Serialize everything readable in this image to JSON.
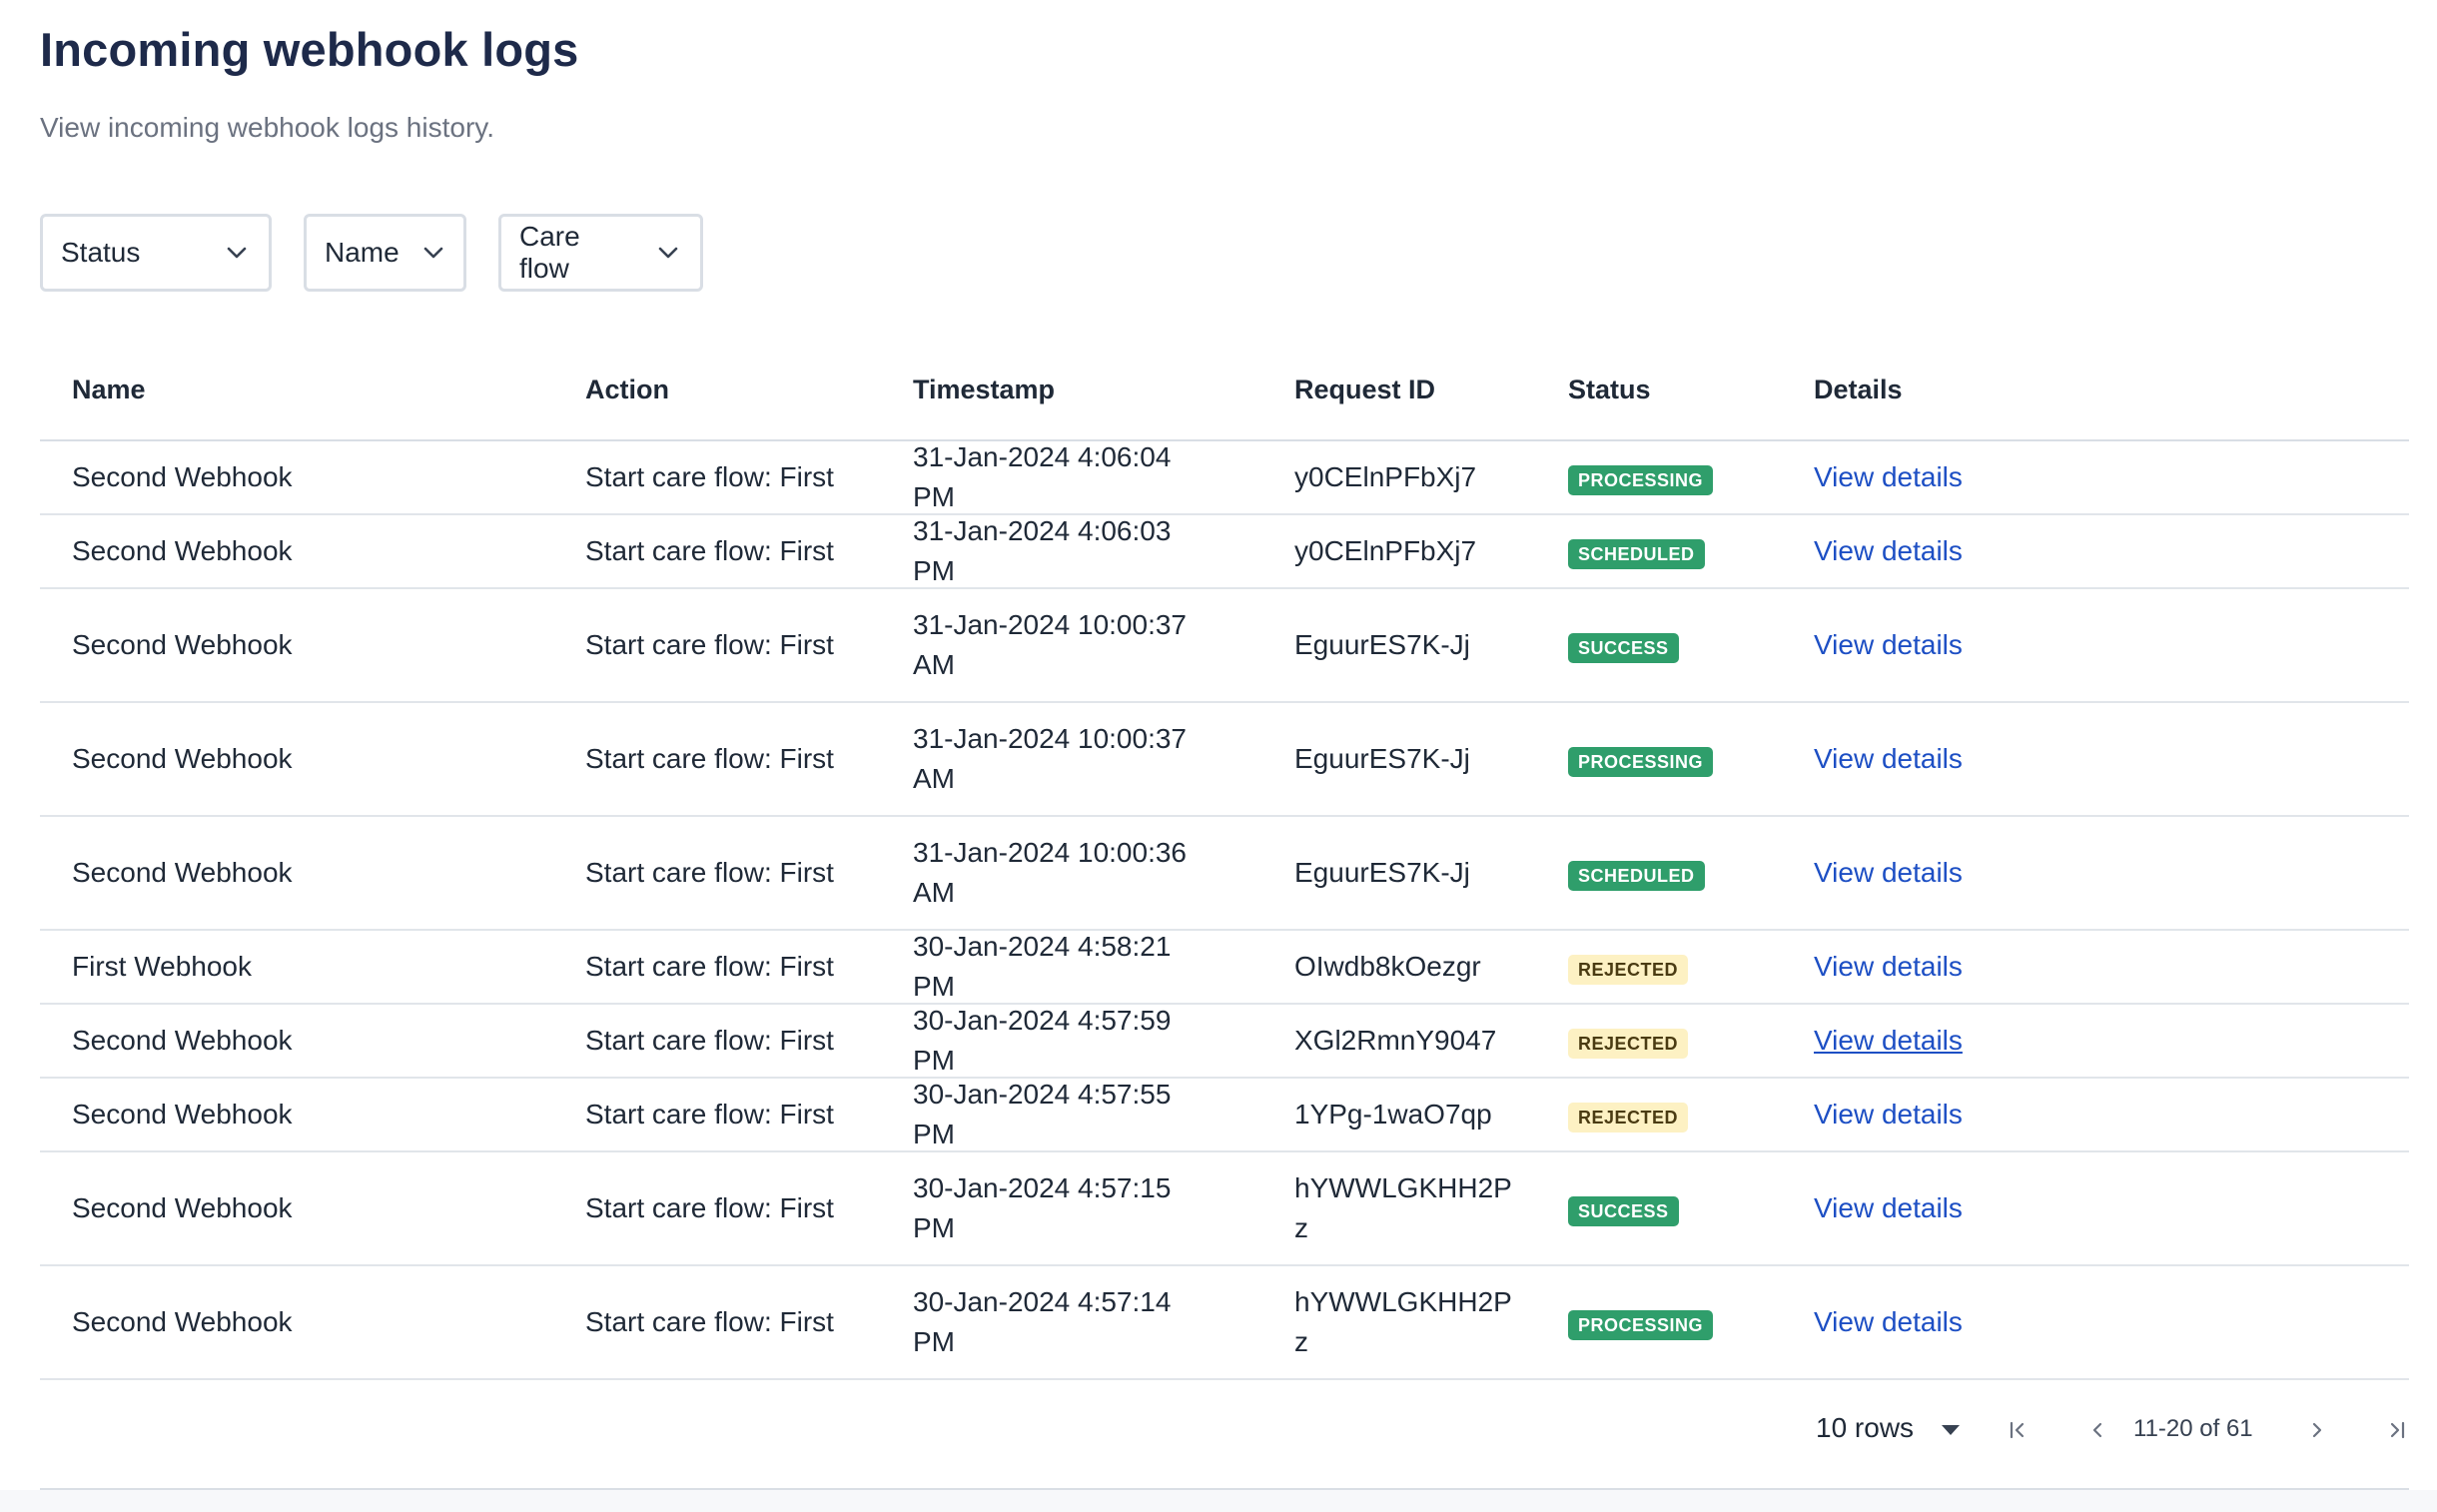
{
  "header": {
    "title": "Incoming webhook logs",
    "subtitle": "View incoming webhook logs history."
  },
  "filters": [
    {
      "label": "Status",
      "icon": "chevron-down-icon"
    },
    {
      "label": "Name",
      "icon": "chevron-down-icon"
    },
    {
      "label": "Care flow",
      "icon": "chevron-down-icon"
    }
  ],
  "table": {
    "columns": [
      "Name",
      "Action",
      "Timestamp",
      "Request ID",
      "Status",
      "Details"
    ],
    "rows": [
      {
        "name": "Second Webhook",
        "action": "Start care flow: First",
        "timestamp": "31-Jan-2024 4:06:04 PM",
        "request_id": "y0CElnPFbXj7",
        "status": "PROCESSING",
        "details": "View details"
      },
      {
        "name": "Second Webhook",
        "action": "Start care flow: First",
        "timestamp": "31-Jan-2024 4:06:03 PM",
        "request_id": "y0CElnPFbXj7",
        "status": "SCHEDULED",
        "details": "View details"
      },
      {
        "name": "Second Webhook",
        "action": "Start care flow: First",
        "timestamp": "31-Jan-2024 10:00:37 AM",
        "request_id": "EguurES7K-Jj",
        "status": "SUCCESS",
        "details": "View details"
      },
      {
        "name": "Second Webhook",
        "action": "Start care flow: First",
        "timestamp": "31-Jan-2024 10:00:37 AM",
        "request_id": "EguurES7K-Jj",
        "status": "PROCESSING",
        "details": "View details"
      },
      {
        "name": "Second Webhook",
        "action": "Start care flow: First",
        "timestamp": "31-Jan-2024 10:00:36 AM",
        "request_id": "EguurES7K-Jj",
        "status": "SCHEDULED",
        "details": "View details"
      },
      {
        "name": "First Webhook",
        "action": "Start care flow: First",
        "timestamp": "30-Jan-2024 4:58:21 PM",
        "request_id": "OIwdb8kOezgr",
        "status": "REJECTED",
        "details": "View details"
      },
      {
        "name": "Second Webhook",
        "action": "Start care flow: First",
        "timestamp": "30-Jan-2024 4:57:59 PM",
        "request_id": "XGl2RmnY9047",
        "status": "REJECTED",
        "details": "View details"
      },
      {
        "name": "Second Webhook",
        "action": "Start care flow: First",
        "timestamp": "30-Jan-2024 4:57:55 PM",
        "request_id": "1YPg-1waO7qp",
        "status": "REJECTED",
        "details": "View details"
      },
      {
        "name": "Second Webhook",
        "action": "Start care flow: First",
        "timestamp": "30-Jan-2024 4:57:15 PM",
        "request_id": "hYWWLGKHH2Pz",
        "status": "SUCCESS",
        "details": "View details"
      },
      {
        "name": "Second Webhook",
        "action": "Start care flow: First",
        "timestamp": "30-Jan-2024 4:57:14 PM",
        "request_id": "hYWWLGKHH2Pz",
        "status": "PROCESSING",
        "details": "View details"
      }
    ]
  },
  "status_colors": {
    "PROCESSING": "#2f9e6b",
    "SCHEDULED": "#2f9e6b",
    "SUCCESS": "#2f9e6b",
    "REJECTED": "#fdf1c3"
  },
  "pagination": {
    "rows_per_page": "10 rows",
    "range": "11-20 of 61",
    "icons": [
      "first-page-icon",
      "prev-page-icon",
      "next-page-icon",
      "last-page-icon"
    ]
  }
}
